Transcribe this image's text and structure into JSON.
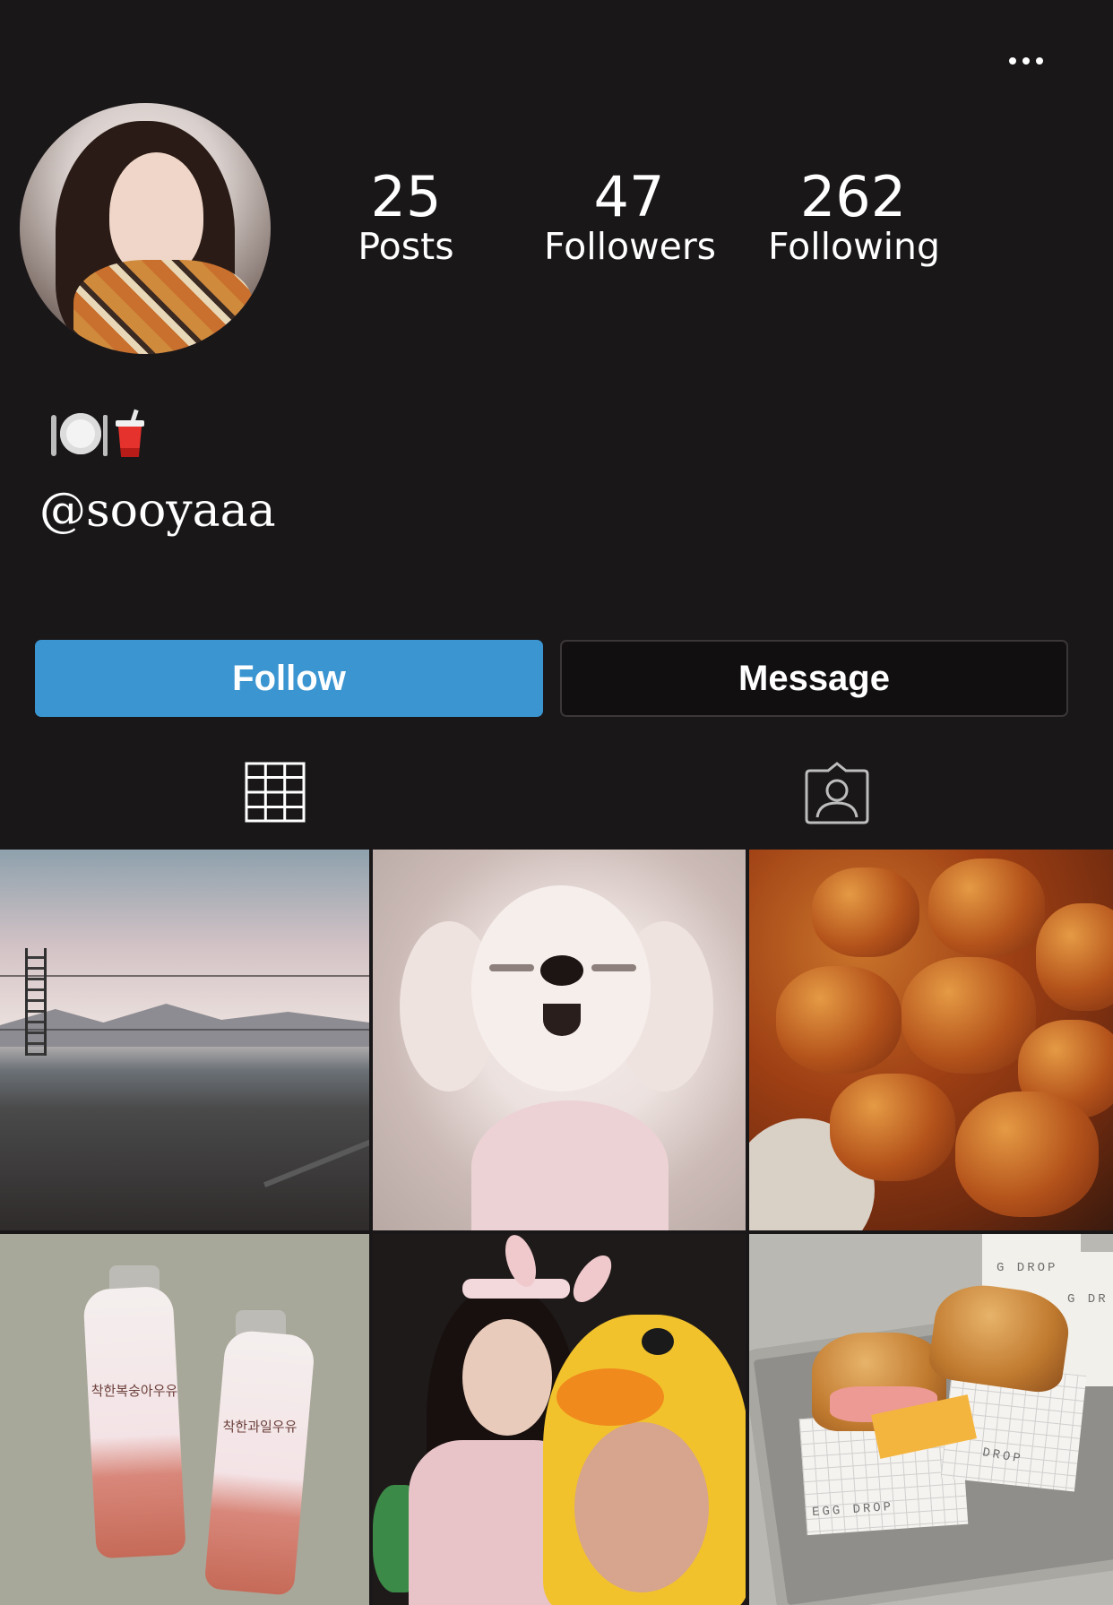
{
  "header": {
    "more_icon": "more-horizontal-icon"
  },
  "profile": {
    "avatar_alt": "profile-photo",
    "stats": {
      "posts": {
        "value": "25",
        "label": "Posts"
      },
      "followers": {
        "value": "47",
        "label": "Followers"
      },
      "following": {
        "value": "262",
        "label": "Following"
      }
    },
    "bio_icons": [
      "plate-with-cutlery-icon",
      "cup-with-straw-icon"
    ],
    "username": "@sooyaaa"
  },
  "actions": {
    "follow_label": "Follow",
    "message_label": "Message"
  },
  "tabs": {
    "grid_icon": "grid-icon",
    "tagged_icon": "tagged-person-icon",
    "active": "grid"
  },
  "posts": [
    {
      "subject": "landscape-sky"
    },
    {
      "subject": "white-puppy"
    },
    {
      "subject": "fried-chicken"
    },
    {
      "subject": "milk-bottles"
    },
    {
      "subject": "friends-in-costumes"
    },
    {
      "subject": "egg-drop-sandwiches"
    }
  ],
  "post_text": {
    "bottle1_label": "착한복숭아우유",
    "bottle2_label": "착한과일우유",
    "cup1_print": "G DROP",
    "cup2_print": "G DR",
    "box1_print": "EGG DROP",
    "box2_print": "DROP"
  },
  "colors": {
    "background": "#1a1719",
    "follow_button": "#3b95d1",
    "message_button": "#110f10"
  }
}
